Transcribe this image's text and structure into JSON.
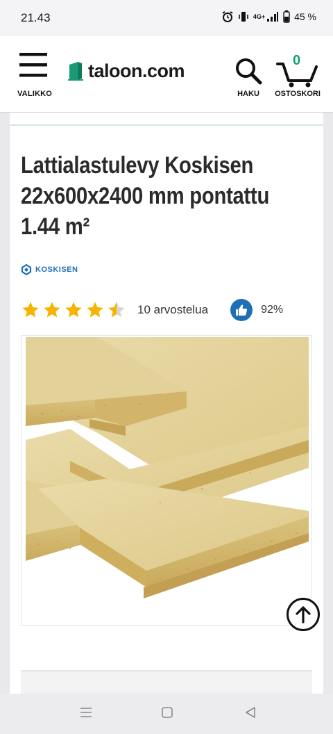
{
  "status_bar": {
    "time": "21.43",
    "battery": "45 %",
    "network": "4G+",
    "icons": [
      "alarm-icon",
      "vibrate-icon",
      "signal-icon",
      "battery-icon"
    ]
  },
  "header": {
    "menu_label": "VALIKKO",
    "logo_text": "taloon.com",
    "search_label": "HAKU",
    "cart_label": "OSTOSKORI",
    "cart_count": "0"
  },
  "product": {
    "title": "Lattialastulevy Koskisen 22x600x2400 mm pontattu 1.44 m²",
    "brand": "KOSKISEN",
    "rating": 4.5,
    "rating_max": 5,
    "reviews": "10 arvostelua",
    "recommend_pct": "92%",
    "image_alt": "chipboard-floor-panels"
  },
  "colors": {
    "accent": "#1b9a76",
    "brand_blue": "#1f6fb6",
    "star": "#f5b400",
    "star_empty": "#d6d6d6",
    "board": "#e6d49f"
  },
  "nav_bar": {
    "icons": [
      "recent-apps-icon",
      "home-icon",
      "back-icon"
    ]
  }
}
